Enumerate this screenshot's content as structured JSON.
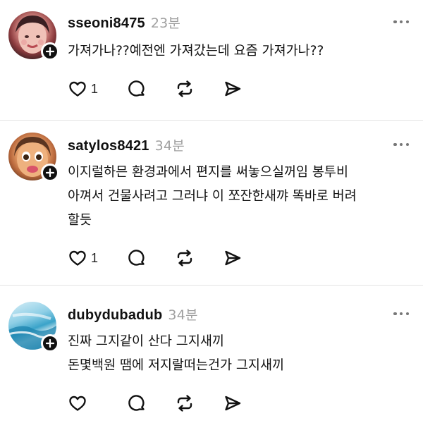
{
  "posts": [
    {
      "username": "sseoni8475",
      "time": "23분",
      "lines": [
        "가져가나??예전엔 가져갔는데 요즘 가져가나??"
      ],
      "likes": "1"
    },
    {
      "username": "satylos8421",
      "time": "34분",
      "lines": [
        "이지럴하믄 환경과에서 편지를 써놓으실꺼임 봉투비",
        "아껴서 건물사려고 그러냐 이 쪼잔한새꺄 똑바로 버려",
        "할듯"
      ],
      "likes": "1"
    },
    {
      "username": "dubydubadub",
      "time": "34분",
      "lines": [
        "진짜 그지같이 산다 그지새끼",
        "돈몇백원 땜에 저지랄떠는건가 그지새끼"
      ],
      "likes": ""
    }
  ],
  "icons": {
    "like": "heart-icon",
    "reply": "comment-bubble-icon",
    "repost": "repost-icon",
    "share": "send-icon",
    "more": "more-dots-icon",
    "follow": "plus-icon"
  },
  "colors": {
    "text": "#111111",
    "muted": "#a0a0a0",
    "divider": "#e3e3e3",
    "badge": "#111111"
  }
}
